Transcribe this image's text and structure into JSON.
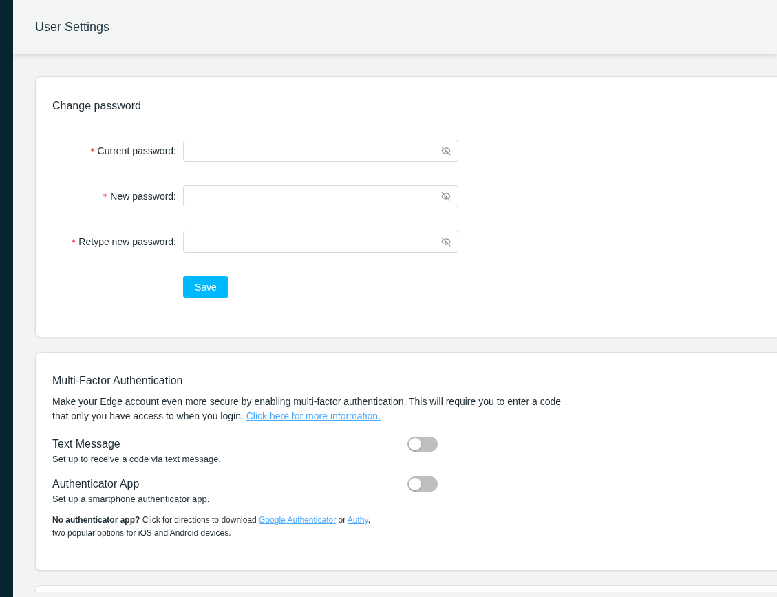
{
  "header": {
    "title": "User Settings"
  },
  "password_card": {
    "title": "Change password",
    "fields": [
      {
        "required_mark": "*",
        "label": "Current password:"
      },
      {
        "required_mark": "*",
        "label": "New password:"
      },
      {
        "required_mark": "*",
        "label": "Retype new password:"
      }
    ],
    "save_button": "Save"
  },
  "mfa_card": {
    "title": "Multi-Factor Authentication",
    "intro": [
      {
        "kind": "text",
        "text": "Make your Edge account even more secure by enabling multi-factor authentication. This will require you to enter a code that only you have access to when you login. "
      },
      {
        "kind": "link",
        "text": "Click here for more information."
      }
    ],
    "options": [
      {
        "title": "Text Message",
        "description": "Set up to receive a code via text message.",
        "on": false
      },
      {
        "title": "Authenticator App",
        "description": "Set up a smartphone authenticator app.",
        "on": false
      }
    ],
    "note": [
      {
        "kind": "text",
        "text": "**No authenticator app?** Click for directions to download "
      },
      {
        "kind": "link",
        "text": "Google Authenticator"
      },
      {
        "kind": "text",
        "text": " or "
      },
      {
        "kind": "link",
        "text": "Authy"
      },
      {
        "kind": "text",
        "text": ",\ntwo popular options for iOS and Android devices."
      }
    ]
  }
}
